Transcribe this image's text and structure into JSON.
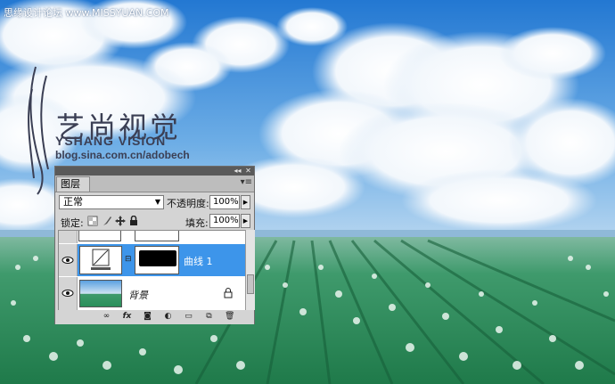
{
  "watermark_top": "思缘设计论坛 www.MISSYUAN.COM",
  "logo": {
    "cn": "艺尚视觉",
    "en": "YSHANG VISION",
    "url": "blog.sina.com.cn/adobech"
  },
  "panel": {
    "tab_label": "图层",
    "blend_mode": "正常",
    "opacity_label": "不透明度:",
    "opacity_value": "100%",
    "lock_label": "锁定:",
    "fill_label": "填充:",
    "fill_value": "100%",
    "layers": [
      {
        "name": "",
        "selected": false
      },
      {
        "name": "曲线 1",
        "selected": true
      },
      {
        "name": "背景",
        "selected": false,
        "locked": true
      }
    ]
  },
  "colors": {
    "selected_layer": "#3d95ea",
    "sky_top": "#2a7fd6",
    "field_green": "#2a8f5a"
  },
  "icons": [
    "link-icon",
    "fx-icon",
    "mask-icon",
    "adjustment-icon",
    "group-icon",
    "new-layer-icon",
    "trash-icon"
  ]
}
